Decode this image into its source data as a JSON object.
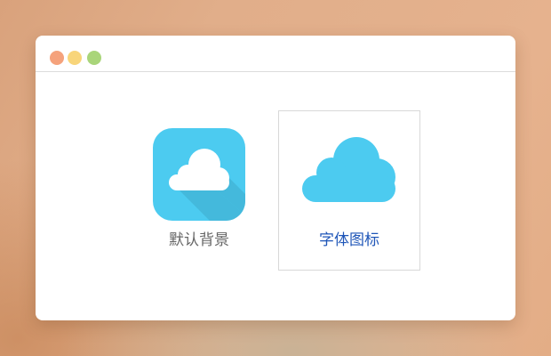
{
  "window": {
    "traffic_lights": {
      "close_color": "#f5a27c",
      "minimize_color": "#f8d57a",
      "maximize_color": "#a9d57a"
    }
  },
  "tiles": [
    {
      "label": "默认背景",
      "icon": "cloud-app-icon",
      "label_color": "#666666",
      "icon_bg_color": "#4ccbf0",
      "icon_shadow_color": "#44b9dc",
      "cloud_color": "#ffffff",
      "selected": false
    },
    {
      "label": "字体图标",
      "icon": "cloud-icon",
      "label_color": "#1f56b8",
      "cloud_color": "#4ccbf0",
      "selected": true
    }
  ]
}
